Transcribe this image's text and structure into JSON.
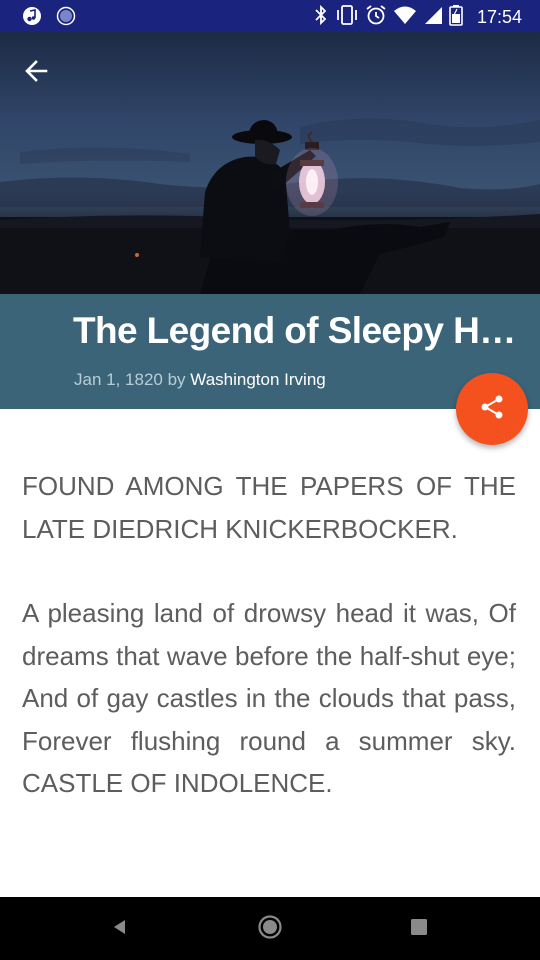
{
  "status_bar": {
    "time": "17:54",
    "left_icons": [
      "music-note-icon",
      "circle-app-icon"
    ],
    "right_icons": [
      "bluetooth-icon",
      "vibrate-icon",
      "alarm-icon",
      "wifi-icon",
      "signal-icon",
      "battery-icon"
    ]
  },
  "header": {
    "back_icon": "arrow-left-icon"
  },
  "article": {
    "title": "The Legend of Sleepy Hollow",
    "date": "Jan 1, 1820",
    "by_label": "by",
    "author": "Washington Irving",
    "paragraphs": [
      "FOUND AMONG THE PAPERS OF THE LATE DIEDRICH KNICKERBOCKER.",
      "A pleasing land of drowsy head it was, Of dreams that wave before the half-shut eye; And of gay castles in the clouds that pass, Forever flushing round a summer sky. CASTLE OF INDOLENCE."
    ]
  },
  "share_button": {
    "icon": "share-icon",
    "color": "#f5511e"
  },
  "nav_bar": {
    "back_icon": "nav-back-icon",
    "home_icon": "nav-home-icon",
    "recents_icon": "nav-recents-icon"
  },
  "colors": {
    "status_bar": "#1a237e",
    "title_band": "#3b6478",
    "body_text": "#5d5d5d"
  }
}
